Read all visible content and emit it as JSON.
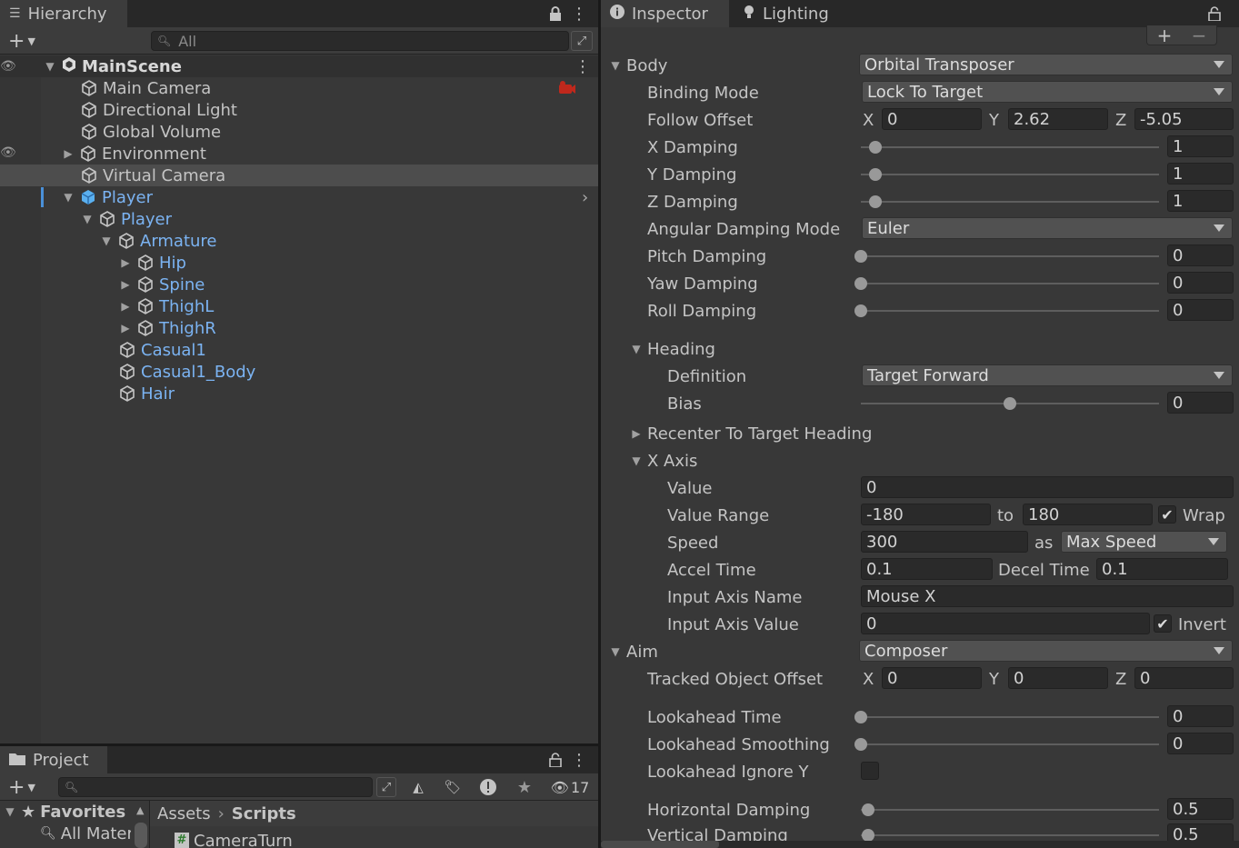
{
  "hierarchy": {
    "tab_title": "Hierarchy",
    "search_placeholder": "All",
    "scene_name": "MainScene",
    "items": [
      {
        "label": "Main Camera"
      },
      {
        "label": "Directional Light"
      },
      {
        "label": "Global Volume"
      },
      {
        "label": "Environment"
      },
      {
        "label": "Virtual Camera"
      },
      {
        "label": "Player"
      },
      {
        "label": "Player"
      },
      {
        "label": "Armature"
      },
      {
        "label": "Hip"
      },
      {
        "label": "Spine"
      },
      {
        "label": "ThighL"
      },
      {
        "label": "ThighR"
      },
      {
        "label": "Casual1"
      },
      {
        "label": "Casual1_Body"
      },
      {
        "label": "Hair"
      }
    ]
  },
  "project": {
    "tab_title": "Project",
    "hidden_count": "17",
    "favorites_label": "Favorites",
    "favorites_item": "All Mater",
    "breadcrumb": {
      "root": "Assets",
      "current": "Scripts"
    },
    "file": "CameraTurn"
  },
  "inspector_tabs": {
    "inspector": "Inspector",
    "lighting": "Lighting"
  },
  "inspector": {
    "body": {
      "label": "Body",
      "value": "Orbital Transposer",
      "binding_mode": {
        "label": "Binding Mode",
        "value": "Lock To Target"
      },
      "follow_offset": {
        "label": "Follow Offset",
        "x_label": "X",
        "x": "0",
        "y_label": "Y",
        "y": "2.62",
        "z_label": "Z",
        "z": "-5.05"
      },
      "x_damping": {
        "label": "X Damping",
        "value": "1",
        "fraction": 0.05
      },
      "y_damping": {
        "label": "Y Damping",
        "value": "1",
        "fraction": 0.05
      },
      "z_damping": {
        "label": "Z Damping",
        "value": "1",
        "fraction": 0.05
      },
      "angular_damping_mode": {
        "label": "Angular Damping Mode",
        "value": "Euler"
      },
      "pitch_damping": {
        "label": "Pitch Damping",
        "value": "0",
        "fraction": 0
      },
      "yaw_damping": {
        "label": "Yaw Damping",
        "value": "0",
        "fraction": 0
      },
      "roll_damping": {
        "label": "Roll Damping",
        "value": "0",
        "fraction": 0
      },
      "heading": {
        "label": "Heading",
        "definition": {
          "label": "Definition",
          "value": "Target Forward"
        },
        "bias": {
          "label": "Bias",
          "value": "0",
          "fraction": 0.5
        }
      },
      "recenter": {
        "label": "Recenter To Target Heading"
      },
      "x_axis": {
        "label": "X Axis",
        "value": {
          "label": "Value",
          "value": "0"
        },
        "value_range": {
          "label": "Value Range",
          "min": "-180",
          "to_label": "to",
          "max": "180",
          "wrap_label": "Wrap",
          "wrap_checked": true
        },
        "speed": {
          "label": "Speed",
          "value": "300",
          "as_label": "as",
          "mode": "Max Speed"
        },
        "accel_time": {
          "label": "Accel Time",
          "value": "0.1",
          "decel_label": "Decel Time",
          "decel_value": "0.1"
        },
        "input_axis_name": {
          "label": "Input Axis Name",
          "value": "Mouse X"
        },
        "input_axis_value": {
          "label": "Input Axis Value",
          "value": "0",
          "invert_label": "Invert",
          "invert_checked": true
        }
      }
    },
    "aim": {
      "label": "Aim",
      "value": "Composer",
      "tracked_object_offset": {
        "label": "Tracked Object Offset",
        "x_label": "X",
        "x": "0",
        "y_label": "Y",
        "y": "0",
        "z_label": "Z",
        "z": "0"
      },
      "lookahead_time": {
        "label": "Lookahead Time",
        "value": "0",
        "fraction": 0
      },
      "lookahead_smoothing": {
        "label": "Lookahead Smoothing",
        "value": "0",
        "fraction": 0
      },
      "lookahead_ignore_y": {
        "label": "Lookahead Ignore Y"
      },
      "horizontal_damping": {
        "label": "Horizontal Damping",
        "value": "0.5",
        "fraction": 0.025
      },
      "vertical_damping": {
        "label": "Vertical Damping",
        "value": "0.5",
        "fraction": 0.025
      }
    }
  }
}
